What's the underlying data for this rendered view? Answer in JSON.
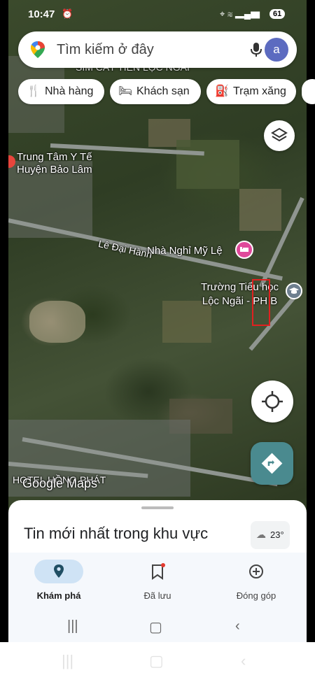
{
  "status_bar": {
    "time": "10:47",
    "battery": "61"
  },
  "search": {
    "placeholder": "Tìm kiếm ở đây",
    "avatar_letter": "a"
  },
  "chips": [
    {
      "label": "Nhà hàng",
      "icon": "restaurant-icon"
    },
    {
      "label": "Khách sạn",
      "icon": "hotel-icon"
    },
    {
      "label": "Trạm xăng",
      "icon": "gas-station-icon"
    }
  ],
  "map": {
    "labels": {
      "hospital": "Trung Tâm Y Tế\nHuyện Bảo Lâm",
      "street": "Lê Đại Hành",
      "motel": "Nhà Nghỉ Mỹ Lệ",
      "school": "Trường Tiểu học\nLộc Ngãi - PH B",
      "hotel": "HOTEL HỒNG PHÁT",
      "watermark": "Google Maps",
      "top_partial": "SIM CÁT TIÊN LỘC NGÃI"
    }
  },
  "sheet": {
    "news_title": "Tin mới nhất trong khu vực",
    "temperature": "23°"
  },
  "nav": {
    "items": [
      {
        "label": "Khám phá",
        "icon": "explore-pin-icon",
        "active": true
      },
      {
        "label": "Đã lưu",
        "icon": "bookmark-icon",
        "active": false
      },
      {
        "label": "Đóng góp",
        "icon": "add-circle-icon",
        "active": false
      }
    ]
  },
  "colors": {
    "accent_blue": "#1a73e8",
    "directions_teal": "#4a8a8f",
    "poi_pink": "#e0489a",
    "active_nav_pill": "#cfe3f5"
  }
}
